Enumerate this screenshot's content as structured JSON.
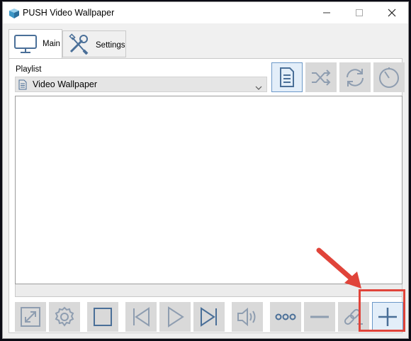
{
  "window": {
    "title": "PUSH Video Wallpaper",
    "controls": [
      "minimize",
      "maximize",
      "close"
    ]
  },
  "tabs": [
    {
      "label": "Main",
      "icon": "monitor-icon",
      "selected": true
    },
    {
      "label": "Settings",
      "icon": "wrench-screwdriver-icon",
      "selected": false
    }
  ],
  "playlist": {
    "label": "Playlist",
    "selected": "Video Wallpaper",
    "icon": "document-icon"
  },
  "playlist_tools": [
    {
      "name": "playlist-button",
      "icon": "document-icon",
      "active": true
    },
    {
      "name": "shuffle-button",
      "icon": "shuffle-icon",
      "active": false
    },
    {
      "name": "repeat-button",
      "icon": "repeat-icon",
      "active": false
    },
    {
      "name": "timer-button",
      "icon": "timer-icon",
      "active": false
    }
  ],
  "bottom_toolbar": [
    {
      "name": "fullscreen-button",
      "icon": "expand-icon"
    },
    {
      "name": "gear-button",
      "icon": "gear-icon"
    },
    {
      "name": "stop-button",
      "icon": "stop-icon"
    },
    {
      "name": "previous-button",
      "icon": "previous-icon"
    },
    {
      "name": "play-button",
      "icon": "play-icon"
    },
    {
      "name": "next-button",
      "icon": "next-icon"
    },
    {
      "name": "volume-button",
      "icon": "volume-icon"
    },
    {
      "name": "more-button",
      "icon": "ellipsis-icon"
    },
    {
      "name": "remove-button",
      "icon": "minus-icon"
    },
    {
      "name": "add-url-button",
      "icon": "link-add-icon"
    },
    {
      "name": "add-button",
      "icon": "plus-icon"
    }
  ],
  "annotation": {
    "highlight_color": "#e0443a",
    "target": "add-button"
  },
  "colors": {
    "icon": "#7a8ba0",
    "icon_active": "#4a6f98",
    "button_bg": "#d9d9d9",
    "button_active_bg": "#e3eef9"
  }
}
